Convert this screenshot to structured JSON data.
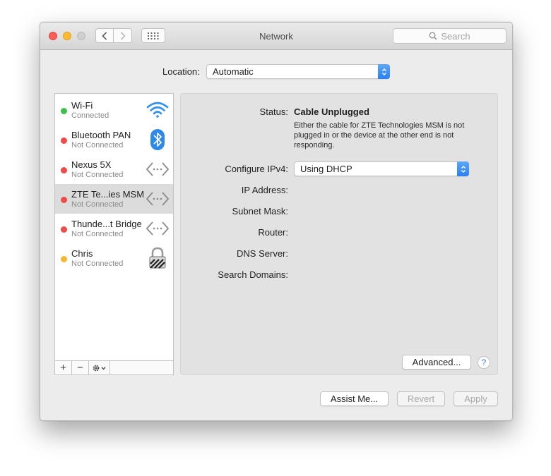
{
  "window": {
    "title": "Network"
  },
  "toolbar": {
    "search_placeholder": "Search"
  },
  "location": {
    "label": "Location:",
    "value": "Automatic"
  },
  "services": [
    {
      "name": "Wi-Fi",
      "status": "Connected",
      "status_color": "#3cc04b",
      "icon": "wifi-icon"
    },
    {
      "name": "Bluetooth PAN",
      "status": "Not Connected",
      "status_color": "#f04b48",
      "icon": "bluetooth-icon"
    },
    {
      "name": "Nexus 5X",
      "status": "Not Connected",
      "status_color": "#f04b48",
      "icon": "ethernet-arrows-icon"
    },
    {
      "name": "ZTE Te...ies MSM",
      "status": "Not Connected",
      "status_color": "#f04b48",
      "icon": "ethernet-arrows-icon",
      "selected": true
    },
    {
      "name": "Thunde...t Bridge",
      "status": "Not Connected",
      "status_color": "#f04b48",
      "icon": "ethernet-arrows-icon"
    },
    {
      "name": "Chris",
      "status": "Not Connected",
      "status_color": "#f5b72e",
      "icon": "vpn-lock-icon"
    }
  ],
  "sidebar_controls": {
    "add": "+",
    "remove": "−"
  },
  "detail": {
    "status_label": "Status:",
    "status_value": "Cable Unplugged",
    "status_description": "Either the cable for ZTE Technologies MSM is not plugged in or the device at the other end is not responding.",
    "configure_label": "Configure IPv4:",
    "configure_value": "Using DHCP",
    "ip_label": "IP Address:",
    "subnet_label": "Subnet Mask:",
    "router_label": "Router:",
    "dns_label": "DNS Server:",
    "search_domains_label": "Search Domains:",
    "advanced_label": "Advanced...",
    "help_label": "?"
  },
  "footer": {
    "assist_label": "Assist Me...",
    "revert_label": "Revert",
    "apply_label": "Apply"
  },
  "colors": {
    "accent": "#2a7ff2",
    "connected": "#3cc04b",
    "not_connected": "#f04b48",
    "pending": "#f5b72e"
  }
}
